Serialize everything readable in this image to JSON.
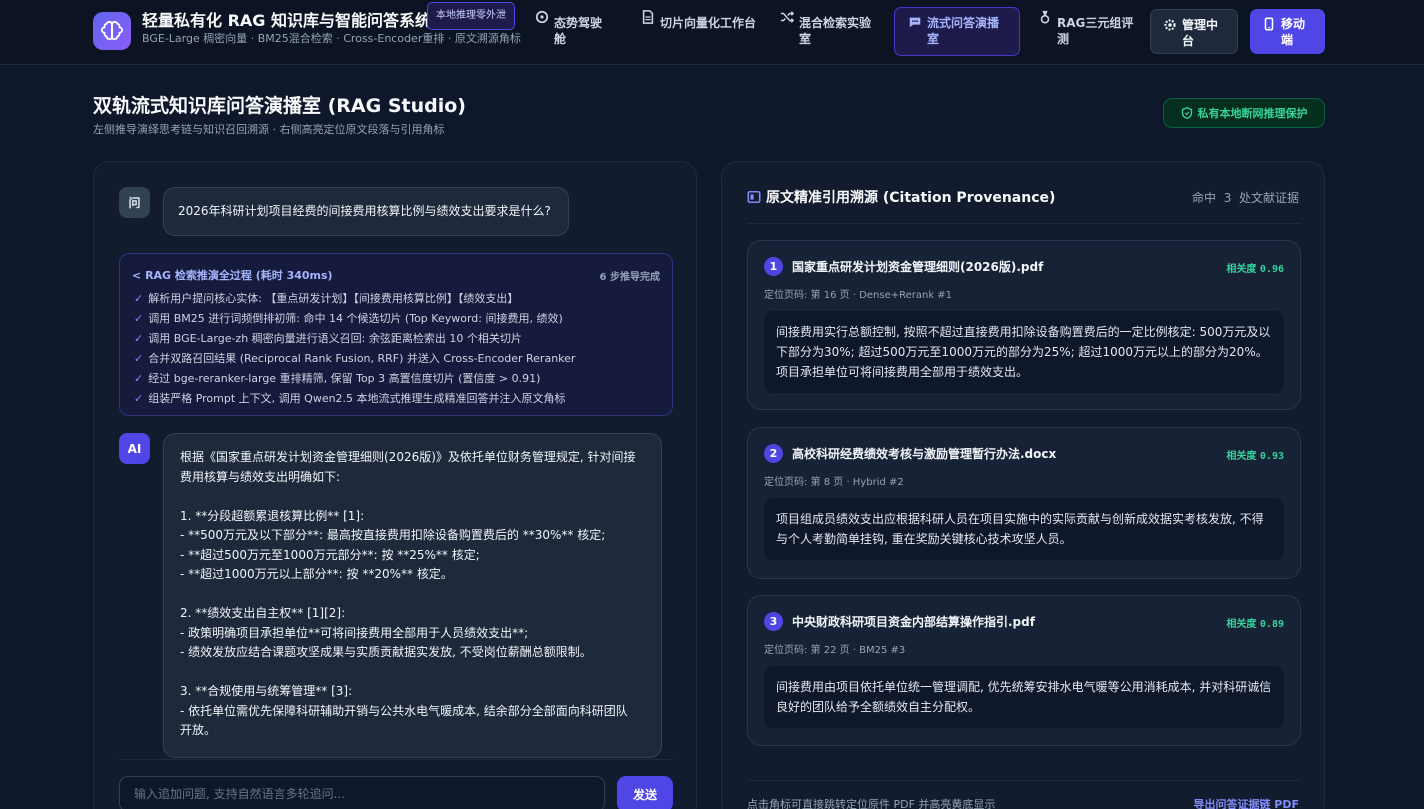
{
  "header": {
    "title": "轻量私有化 RAG 知识库与智能问答系统",
    "badge": "本地推理零外泄",
    "subtitle": "BGE-Large 稠密向量 · BM25混合检索 · Cross-Encoder重排 · 原文溯源角标",
    "nav": [
      {
        "label": "态势驾驶舱",
        "icon": "dashboard-icon"
      },
      {
        "label": "切片向量化工作台",
        "icon": "document-icon"
      },
      {
        "label": "混合检索实验室",
        "icon": "shuffle-icon"
      },
      {
        "label": "流式问答演播室",
        "icon": "chat-icon",
        "active": true
      },
      {
        "label": "RAG三元组评测",
        "icon": "medal-icon"
      }
    ],
    "admin_label": "管理中台",
    "mobile_label": "移动端"
  },
  "page": {
    "title": "双轨流式知识库问答演播室 (RAG Studio)",
    "subtitle": "左侧推导演绎思考链与知识召回溯源 · 右侧高亮定位原文段落与引用角标",
    "privacy_badge": "私有本地断网推理保护"
  },
  "chat": {
    "user_avatar": "问",
    "question": "2026年科研计划项目经费的间接费用核算比例与绩效支出要求是什么?",
    "trace_title": "RAG 检索推演全过程 (耗时 340ms)",
    "trace_count": "6 步推导完成",
    "trace_steps": [
      "解析用户提问核心实体: 【重点研发计划】【间接费用核算比例】【绩效支出】",
      "调用 BM25 进行词频倒排初筛: 命中 14 个候选切片 (Top Keyword: 间接费用, 绩效)",
      "调用 BGE-Large-zh 稠密向量进行语义召回: 余弦距离检索出 10 个相关切片",
      "合并双路召回结果 (Reciprocal Rank Fusion, RRF) 并送入 Cross-Encoder Reranker",
      "经过 bge-reranker-large 重排精筛, 保留 Top 3 高置信度切片 (置信度 > 0.91)",
      "组装严格 Prompt 上下文, 调用 Qwen2.5 本地流式推理生成精准回答并注入原文角标"
    ],
    "ai_avatar": "AI",
    "answer_lines": [
      "根据《国家重点研发计划资金管理细则(2026版)》及依托单位财务管理规定, 针对间接",
      "费用核算与绩效支出明确如下:",
      "",
      "1. **分段超额累退核算比例** [1]:",
      "- **500万元及以下部分**: 最高按直接费用扣除设备购置费后的 **30%** 核定;",
      "- **超过500万元至1000万元部分**: 按 **25%** 核定;",
      "- **超过1000万元以上部分**: 按 **20%** 核定。",
      "",
      "2. **绩效支出自主权** [1][2]:",
      "- 政策明确项目承担单位**可将间接费用全部用于人员绩效支出**;",
      "- 绩效发放应结合课题攻坚成果与实质贡献据实发放, 不受岗位薪酬总额限制。",
      "",
      "3. **合规使用与统筹管理** [3]:",
      "- 依托单位需优先保障科研辅助开销与公共水电气暖成本, 结余部分全部面向科研团队",
      "开放。"
    ],
    "input_placeholder": "输入追加问题, 支持自然语言多轮追问...",
    "send_label": "发送"
  },
  "citations": {
    "title": "原文精准引用溯源 (Citation Provenance)",
    "hits_prefix": "命中",
    "hits_count": "3",
    "hits_suffix": "处文献证据",
    "score_label": "相关度",
    "cards": [
      {
        "num": "1",
        "title": "国家重点研发计划资金管理细则(2026版).pdf",
        "score": "0.96",
        "meta": "定位页码: 第 16 页 · Dense+Rerank #1",
        "quote": "间接费用实行总额控制, 按照不超过直接费用扣除设备购置费后的一定比例核定: 500万元及以下部分为30%; 超过500万元至1000万元的部分为25%; 超过1000万元以上的部分为20%。项目承担单位可将间接费用全部用于绩效支出。"
      },
      {
        "num": "2",
        "title": "高校科研经费绩效考核与激励管理暂行办法.docx",
        "score": "0.93",
        "meta": "定位页码: 第 8 页 · Hybrid #2",
        "quote": "项目组成员绩效支出应根据科研人员在项目实施中的实际贡献与创新成效据实考核发放, 不得与个人考勤简单挂钩, 重在奖励关键核心技术攻坚人员。"
      },
      {
        "num": "3",
        "title": "中央财政科研项目资金内部结算操作指引.pdf",
        "score": "0.89",
        "meta": "定位页码: 第 22 页 · BM25 #3",
        "quote": "间接费用由项目依托单位统一管理调配, 优先统筹安排水电气暖等公用消耗成本, 并对科研诚信良好的团队给予全额绩效自主分配权。"
      }
    ],
    "footer_hint": "点击角标可直接跳转定位原件 PDF 并高亮黄底显示",
    "export_label": "导出问答证据链 PDF"
  }
}
